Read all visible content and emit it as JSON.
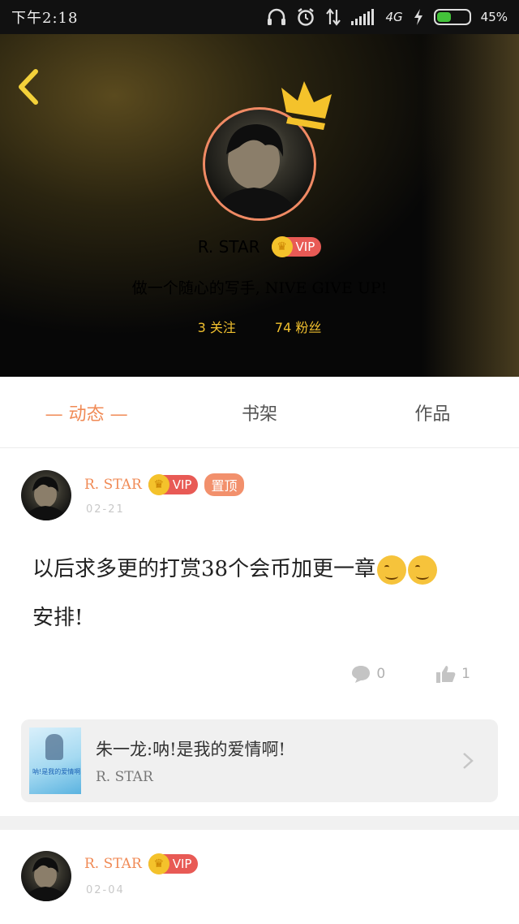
{
  "status_bar": {
    "time": "下午2:18",
    "network": "4G",
    "battery_percent": "45%",
    "battery_level": 0.45,
    "icons": [
      "headphones-icon",
      "alarm-icon",
      "data-arrows-icon",
      "signal-icon",
      "charging-icon",
      "battery-icon"
    ]
  },
  "header": {
    "username": "R. STAR",
    "vip": "VIP",
    "bio": "做一个随心的写手, NIVE GIVE UP!",
    "following": "3 关注",
    "followers": "74 粉丝",
    "colors": {
      "avatar_ring": "#f08a64",
      "crown": "#f4c22b",
      "stats": "#f1c02e"
    }
  },
  "tabs": [
    {
      "label": "— 动态 —",
      "active": true
    },
    {
      "label": "书架",
      "active": false
    },
    {
      "label": "作品",
      "active": false
    }
  ],
  "posts": [
    {
      "author": "R. STAR",
      "vip": "VIP",
      "pinned_label": "置顶",
      "date": "02-21",
      "text": "以后求多更的打赏38个会币加更一章",
      "text_tail": "安排!",
      "comments": "0",
      "likes": "1",
      "book": {
        "title": "朱一龙:呐!是我的爱情啊!",
        "author": "R. STAR",
        "cover_text": "呐!是我的爱情啊"
      }
    },
    {
      "author": "R. STAR",
      "vip": "VIP",
      "date": "02-04"
    }
  ],
  "accent_color": "#f08a55"
}
